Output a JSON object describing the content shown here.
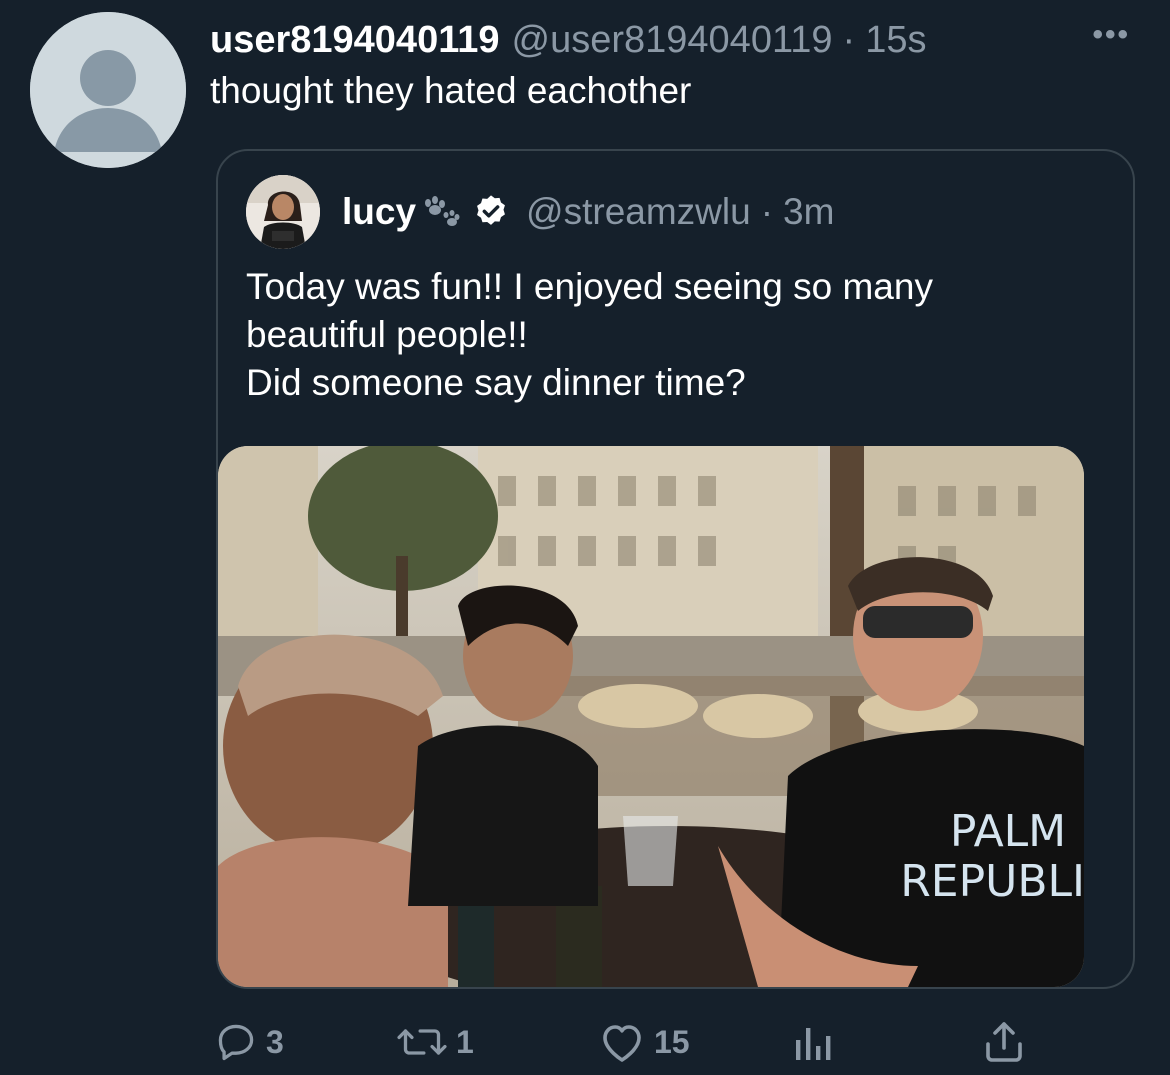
{
  "tweet": {
    "display_name": "user8194040119",
    "handle": "@user8194040119",
    "separator": "·",
    "time": "15s",
    "more_icon": "more-horizontal-icon",
    "text": "thought they hated eachother"
  },
  "quoted_tweet": {
    "display_name": "lucy",
    "name_emoji": "paw-prints-icon",
    "verified_icon": "verified-badge-icon",
    "handle": "@streamzwlu",
    "separator": "·",
    "time": "3m",
    "text_lines": [
      "Today was fun!! I enjoyed seeing so  many",
      "beautiful people!!",
      "Did someone say dinner time?"
    ],
    "photo": {
      "description_icon": "photo-image",
      "shirt_text_line1": "PALM",
      "shirt_text_line2": "REPUBLIC"
    }
  },
  "actions": {
    "reply": {
      "icon": "reply-icon",
      "count": "3"
    },
    "retweet": {
      "icon": "retweet-icon",
      "count": "1"
    },
    "like": {
      "icon": "heart-icon",
      "count": "15"
    },
    "analytics": {
      "icon": "analytics-icon"
    },
    "share": {
      "icon": "share-icon"
    }
  },
  "colors": {
    "background": "#15202b",
    "primary_text": "#ffffff",
    "secondary_text": "#8b98a5",
    "border": "#38444d",
    "verified": "#ffffff"
  }
}
